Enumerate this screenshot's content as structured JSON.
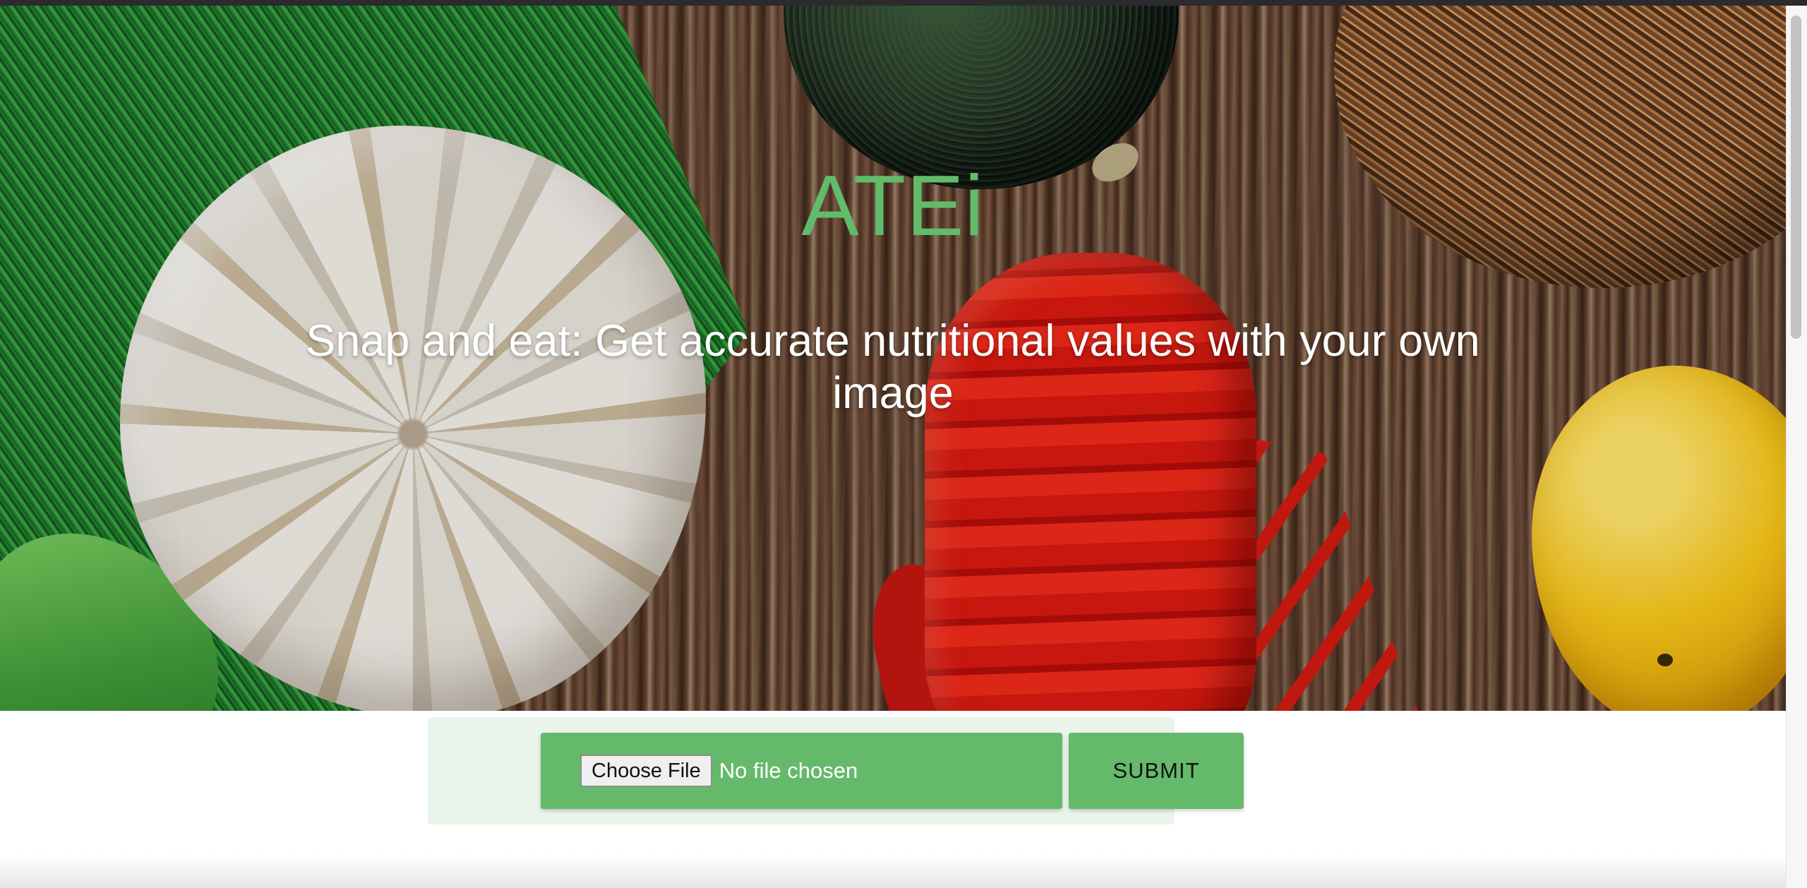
{
  "hero": {
    "title": "ATEi",
    "subtitle": "Snap and eat: Get accurate nutritional values with your own image",
    "background_image": "food-ingredients-on-wood-table"
  },
  "upload": {
    "choose_file_label": "Choose File",
    "file_status": "No file chosen",
    "submit_label": "SUBMIT"
  },
  "colors": {
    "brand_green": "#65b96b",
    "title_green": "#62bb6b",
    "panel_bg": "#e9f5ea"
  }
}
